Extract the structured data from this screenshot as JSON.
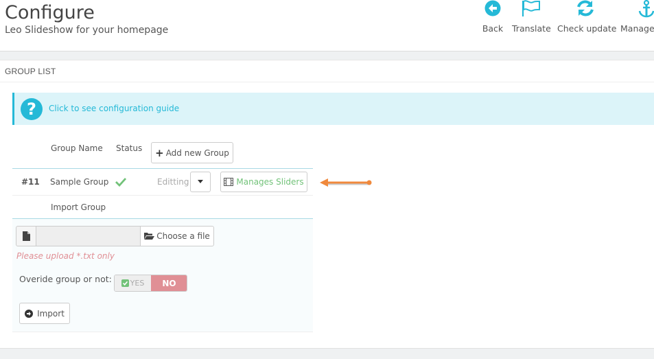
{
  "header": {
    "title": "Configure",
    "subtitle": "Leo Slideshow for your homepage"
  },
  "toolbar": {
    "back_label": "Back",
    "translate_label": "Translate",
    "check_update_label": "Check update",
    "manage_label": "Manage"
  },
  "panel": {
    "heading": "GROUP LIST"
  },
  "guide": {
    "icon": "question-circle-icon",
    "link_text": "Click to see configuration guide"
  },
  "table": {
    "headers": {
      "group_name": "Group Name",
      "status": "Status"
    },
    "add_button": "Add new Group",
    "rows": [
      {
        "id": "#11",
        "name": "Sample Group",
        "status_icon": "check-icon",
        "action_label": "Editting",
        "manage_label": "Manages Sliders"
      }
    ]
  },
  "import": {
    "title": "Import Group",
    "file_value": "",
    "choose_label": "Choose a file",
    "hint": "Please upload *.txt only",
    "override_label": "Overide group or not:",
    "toggle_yes": "YES",
    "toggle_no": "NO",
    "toggle_selected": "NO",
    "import_button": "Import"
  },
  "colors": {
    "accent": "#25b9d7",
    "success": "#72c279",
    "danger": "#e08f95",
    "arrow": "#f0893c"
  }
}
